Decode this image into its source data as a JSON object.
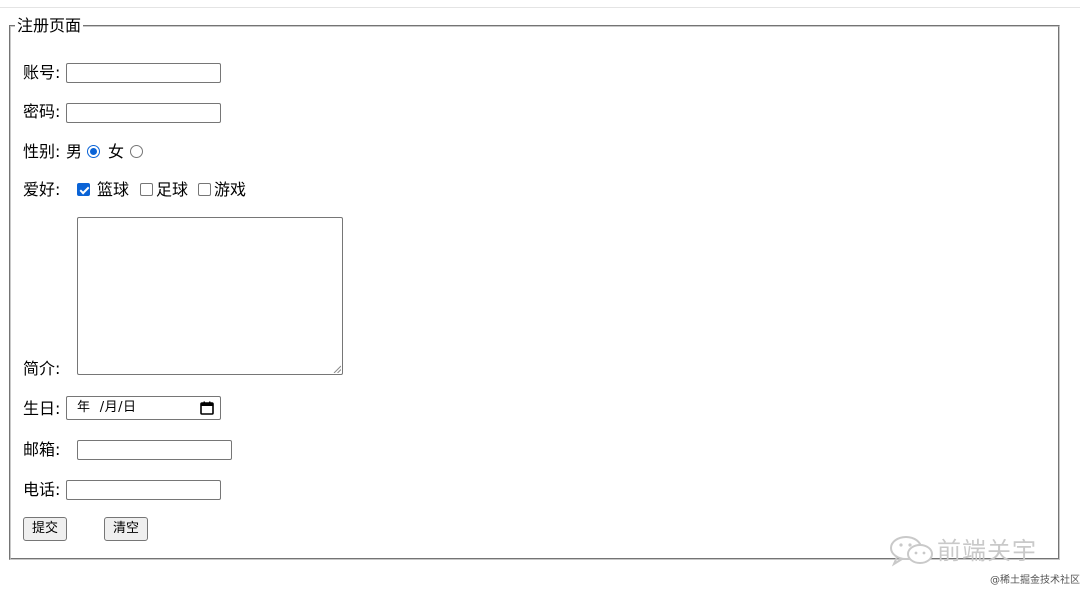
{
  "form": {
    "legend": "注册页面",
    "account_label": "账号:",
    "account_value": "",
    "password_label": "密码:",
    "password_value": "",
    "gender_label": "性别:",
    "gender_male": "男",
    "gender_female": "女",
    "gender_selected": "男",
    "hobby_label": "爱好:",
    "hobbies": [
      {
        "label": "篮球",
        "checked": true
      },
      {
        "label": "足球",
        "checked": false
      },
      {
        "label": "游戏",
        "checked": false
      }
    ],
    "intro_label": "简介:",
    "intro_value": "",
    "birthday_label": "生日:",
    "birthday_placeholder": "年  /月/日",
    "email_label": "邮箱:",
    "email_value": "",
    "phone_label": "电话:",
    "phone_value": "",
    "submit_label": "提交",
    "reset_label": "清空"
  },
  "watermark": {
    "text": "前端关宇",
    "source": "@稀土掘金技术社区"
  },
  "colors": {
    "accent": "#0a63d6",
    "border": "#767676",
    "button_bg": "#efefef",
    "watermark": "#c9c9c9"
  }
}
